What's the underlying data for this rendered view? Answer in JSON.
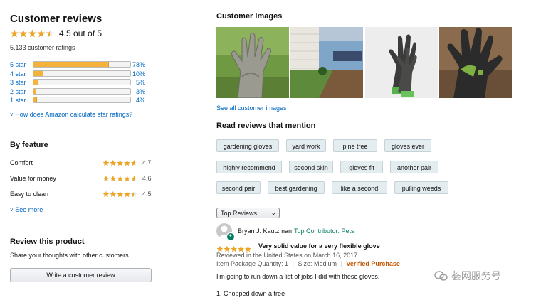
{
  "summary": {
    "title": "Customer reviews",
    "rating": 4.5,
    "rating_text": "4.5 out of 5",
    "ratings_count": "5,133 customer ratings",
    "histogram": [
      {
        "label": "5 star",
        "pct": 78,
        "pct_text": "78%"
      },
      {
        "label": "4 star",
        "pct": 10,
        "pct_text": "10%"
      },
      {
        "label": "3 star",
        "pct": 5,
        "pct_text": "5%"
      },
      {
        "label": "2 star",
        "pct": 3,
        "pct_text": "3%"
      },
      {
        "label": "1 star",
        "pct": 4,
        "pct_text": "4%"
      }
    ],
    "how_calculated": "How does Amazon calculate star ratings?"
  },
  "by_feature": {
    "title": "By feature",
    "items": [
      {
        "name": "Comfort",
        "rating": 4.7,
        "value_text": "4.7"
      },
      {
        "name": "Value for money",
        "rating": 4.6,
        "value_text": "4.6"
      },
      {
        "name": "Easy to clean",
        "rating": 4.5,
        "value_text": "4.5"
      }
    ],
    "see_more": "See more"
  },
  "review_product": {
    "title": "Review this product",
    "subtitle": "Share your thoughts with other customers",
    "button": "Write a customer review"
  },
  "customer_images": {
    "title": "Customer images",
    "see_all": "See all customer images"
  },
  "mentions": {
    "title": "Read reviews that mention",
    "chips": [
      [
        "gardening gloves",
        "yard work",
        "pine tree",
        "gloves ever"
      ],
      [
        "highly recommend",
        "second skin",
        "gloves fit",
        "another pair"
      ],
      [
        "second pair",
        "best gardening",
        "like a second",
        "pulling weeds"
      ]
    ]
  },
  "sort": {
    "selected": "Top Reviews"
  },
  "review": {
    "author": "Bryan J. Kautzman",
    "badge": "Top Contributor: Pets",
    "rating": 5,
    "title": "Very solid value for a very flexible glove",
    "date": "Reviewed in the United States on March 16, 2017",
    "meta_qty": "Item Package Quantity: 1",
    "meta_size": "Size: Medium",
    "verified": "Verified Purchase",
    "body1": "I'm going to run down a list of jobs I did with these gloves.",
    "body2": "1. Chopped down a tree"
  },
  "watermark": "荟网服务号",
  "colors": {
    "star": "#f0a41c",
    "link": "#0066c0",
    "badge": "#067d62",
    "verified": "#c45500"
  }
}
